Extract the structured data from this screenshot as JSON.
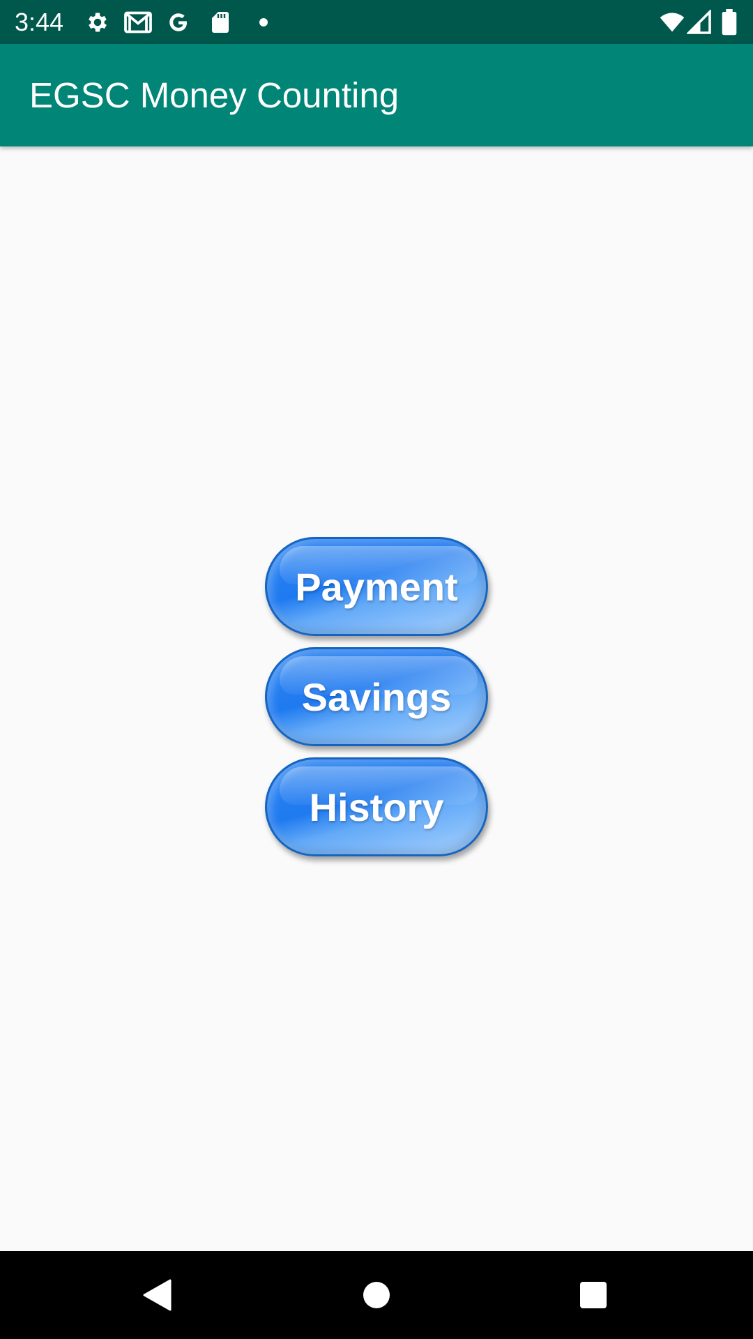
{
  "status_bar": {
    "time": "3:44",
    "left_icons": [
      "gear-icon",
      "gmail-icon",
      "google-g-icon",
      "sd-card-icon",
      "notification-dot-icon"
    ],
    "right_icons": [
      "wifi-icon",
      "cellular-signal-icon",
      "battery-icon"
    ]
  },
  "app_bar": {
    "title": "EGSC Money Counting"
  },
  "main": {
    "buttons": [
      {
        "label": "Payment"
      },
      {
        "label": "Savings"
      },
      {
        "label": "History"
      }
    ]
  },
  "nav_bar": {
    "icons": [
      "back-icon",
      "home-icon",
      "recents-icon"
    ]
  },
  "colors": {
    "status_bar": "#00574b",
    "app_bar": "#008577",
    "button": "#1f7af0",
    "background": "#fafafa"
  }
}
